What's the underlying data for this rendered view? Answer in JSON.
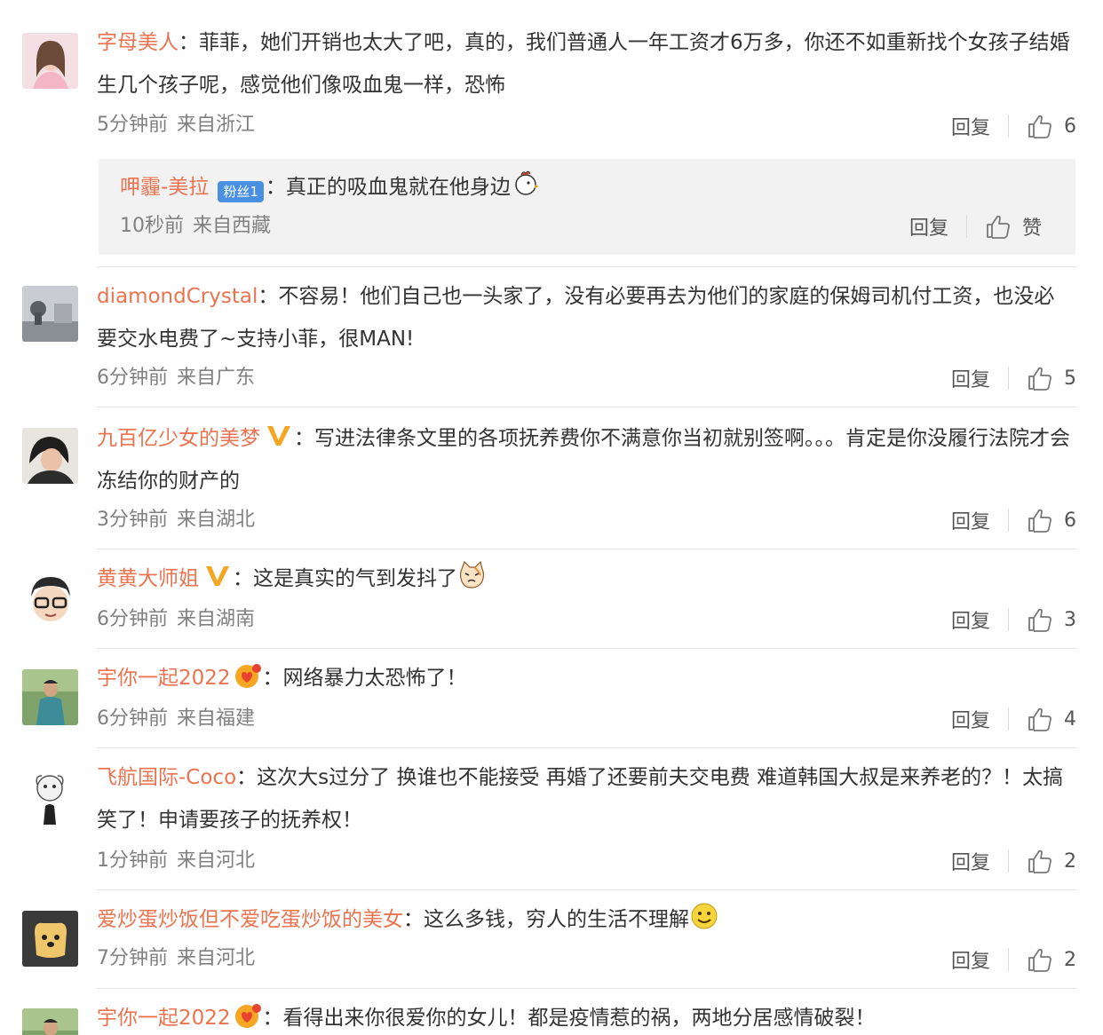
{
  "actions": {
    "reply_label": "回复",
    "like_icon": "thumbs-up-icon"
  },
  "colors": {
    "username": "#eb7350",
    "meta": "#808080",
    "subreply_bg": "#f2f2f2",
    "badge_blue": "#4a90e2"
  },
  "comments": [
    {
      "username": "字母美人",
      "separator": "：",
      "text": "菲菲，她们开销也太大了吧，真的，我们普通人一年工资才6万多，你还不如重新找个女孩子结婚生几个孩子呢，感觉他们像吸血鬼一样，恐怖",
      "time": "5分钟前",
      "location": "来自浙江",
      "likes": "6",
      "reply": {
        "username": "呷霾-美拉",
        "badge": "粉丝1",
        "separator": "：",
        "text": "真正的吸血鬼就在他身边",
        "emoji": "rooster-emoji",
        "time": "10秒前",
        "location": "来自西藏",
        "likes": "赞"
      }
    },
    {
      "username": "diamondCrystal",
      "separator": "：",
      "text": "不容易！他们自己也一头家了，没有必要再去为他们的家庭的保姆司机付工资，也没必要交水电费了~支持小菲，很MAN!",
      "time": "6分钟前",
      "location": "来自广东",
      "likes": "5"
    },
    {
      "username": "九百亿少女的美梦",
      "badge": "verified-v-badge",
      "separator": "：",
      "text": "写进法律条文里的各项抚养费你不满意你当初就别签啊。。。肯定是你没履行法院才会冻结你的财产的",
      "time": "3分钟前",
      "location": "来自湖北",
      "likes": "6"
    },
    {
      "username": "黄黄大师姐",
      "badge": "verified-v-badge",
      "separator": "：",
      "text": "这是真实的气到发抖了",
      "emoji": "cat-emoji",
      "time": "6分钟前",
      "location": "来自湖南",
      "likes": "3"
    },
    {
      "username": "宇你一起2022",
      "badge": "heart-badge",
      "separator": "：",
      "text": "网络暴力太恐怖了！",
      "time": "6分钟前",
      "location": "来自福建",
      "likes": "4"
    },
    {
      "username": "飞航国际-Coco",
      "separator": "：",
      "text": "这次大s过分了 换谁也不能接受 再婚了还要前夫交电费 难道韩国大叔是来养老的？！太搞笑了！申请要孩子的抚养权！",
      "time": "1分钟前",
      "location": "来自河北",
      "likes": "2"
    },
    {
      "username": "爱炒蛋炒饭但不爱吃蛋炒饭的美女",
      "separator": "：",
      "text": "这么多钱，穷人的生活不理解",
      "emoji": "smile-emoji",
      "time": "7分钟前",
      "location": "来自河北",
      "likes": "2"
    },
    {
      "username": "宇你一起2022",
      "badge": "heart-badge",
      "separator": "：",
      "text": "看得出来你很爱你的女儿！都是疫情惹的祸，两地分居感情破裂！"
    }
  ]
}
